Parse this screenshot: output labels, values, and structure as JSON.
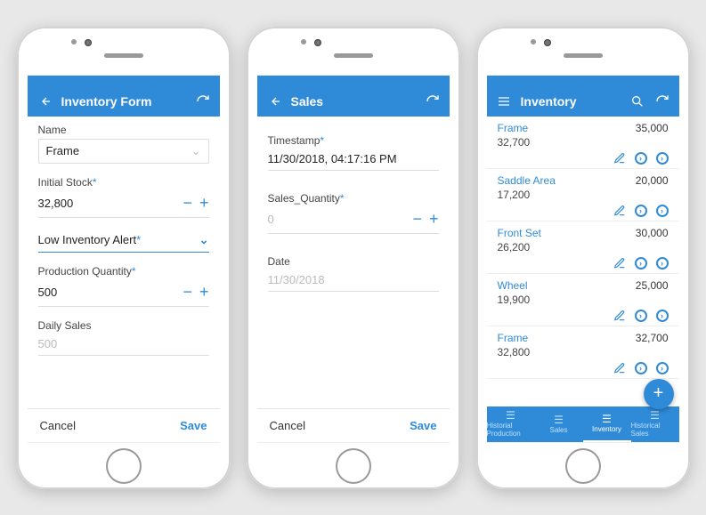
{
  "colors": {
    "accent": "#2f8bd8"
  },
  "phone1": {
    "title": "Inventory Form",
    "fields": {
      "name": {
        "label": "Name",
        "value": "Frame"
      },
      "initial_stock": {
        "label": "Initial Stock",
        "required": true,
        "value": "32,800"
      },
      "low_alert": {
        "label": "Low Inventory Alert",
        "required": true,
        "value": ""
      },
      "prod_qty": {
        "label": "Production Quantity",
        "required": true,
        "value": "500"
      },
      "daily_sales": {
        "label": "Daily Sales",
        "value": "500"
      }
    },
    "footer": {
      "cancel": "Cancel",
      "save": "Save"
    }
  },
  "phone2": {
    "title": "Sales",
    "fields": {
      "timestamp": {
        "label": "Timestamp",
        "required": true,
        "value": "11/30/2018, 04:17:16 PM"
      },
      "sales_qty": {
        "label": "Sales_Quantity",
        "required": true,
        "placeholder": "0",
        "value": ""
      },
      "date": {
        "label": "Date",
        "value": "11/30/2018"
      }
    },
    "footer": {
      "cancel": "Cancel",
      "save": "Save"
    }
  },
  "phone3": {
    "title": "Inventory",
    "items": [
      {
        "name": "Frame",
        "right": "35,000",
        "sub": "32,700"
      },
      {
        "name": "Saddle Area",
        "right": "20,000",
        "sub": "17,200"
      },
      {
        "name": "Front Set",
        "right": "30,000",
        "sub": "26,200"
      },
      {
        "name": "Wheel",
        "right": "25,000",
        "sub": "19,900"
      },
      {
        "name": "Frame",
        "right": "32,700",
        "sub": "32,800"
      }
    ],
    "tabs": [
      {
        "label": "Historial Production"
      },
      {
        "label": "Sales"
      },
      {
        "label": "Inventory",
        "active": true
      },
      {
        "label": "Historical Sales"
      }
    ],
    "fab": "+"
  }
}
